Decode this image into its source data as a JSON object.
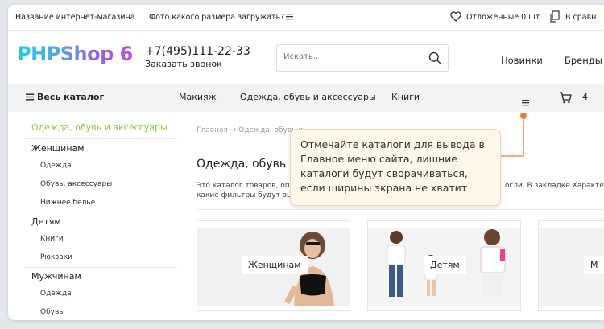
{
  "topbar": {
    "shop_name": "Название интернет-магазина",
    "photo_size": "Фото какого размера загружать?",
    "deferred": "Отложенные 0 шт.",
    "compare": "В сравн"
  },
  "header": {
    "logo": "PHPShop 6",
    "phone": "+7(495)111-22-33",
    "callback": "Заказать звонок",
    "search_placeholder": "Искать..",
    "nav": [
      "Новинки",
      "Бренды"
    ]
  },
  "catalog_bar": {
    "all": "Весь каталог",
    "items": [
      "Макияж",
      "Одежда, обувь и аксессуары",
      "Книги"
    ],
    "cart_count": "4"
  },
  "sidebar": {
    "active": "Одежда, обувь и аксессуары",
    "groups": [
      {
        "name": "Женщинам",
        "subs": [
          "Одежда",
          "Обувь, аксессуары",
          "Нижнее белье"
        ]
      },
      {
        "name": "Детям",
        "subs": [
          "Книги",
          "Рюкзаки"
        ]
      },
      {
        "name": "Мужчинам",
        "subs": [
          "Одежда",
          "Обувь"
        ]
      }
    ]
  },
  "content": {
    "breadcrumb": "Главная → Одежда, обувь и",
    "title": "Одежда, обувь и а",
    "desc_line1_left": "Это каталог товаров, опис",
    "desc_line1_right": "огли. В закладке Характер",
    "desc_line2": "какие фильтры будут выво",
    "cards": [
      "Женщинам",
      "Детям",
      "М"
    ]
  },
  "tooltip": {
    "lines": [
      "Отмечайте каталоги для вывода в",
      "Главное меню сайта, лишние",
      "каталоги будут сворачиваться,",
      "если ширины экрана не хватит"
    ]
  },
  "colors": {
    "accent_green": "#8cc63f",
    "tooltip_dot": "#f07a2a"
  }
}
